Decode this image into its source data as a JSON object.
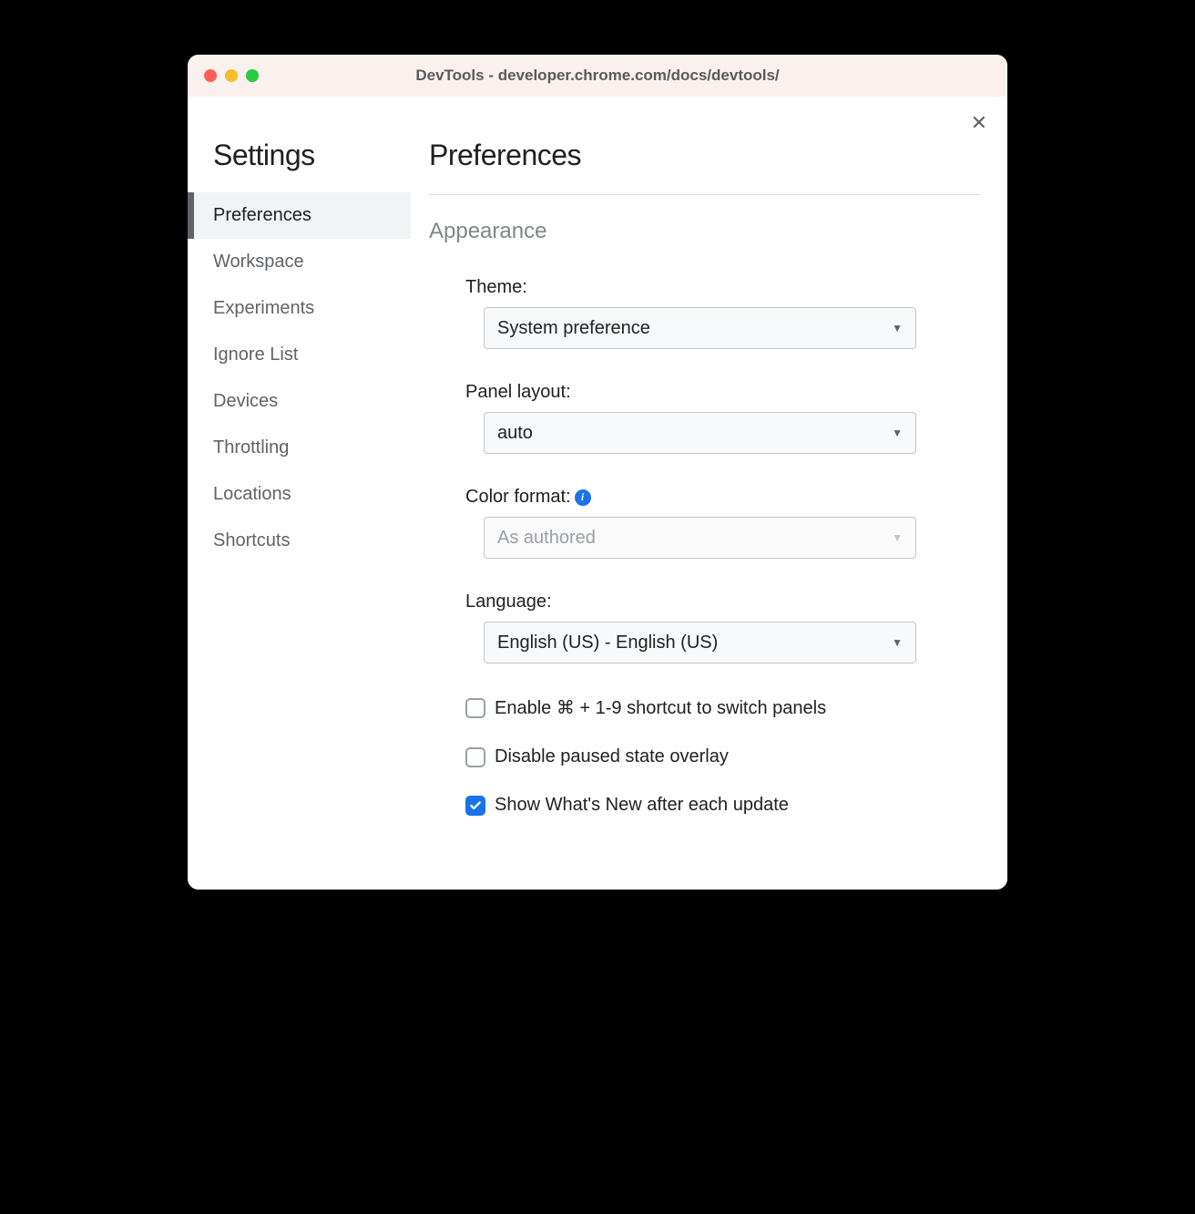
{
  "window": {
    "title": "DevTools - developer.chrome.com/docs/devtools/"
  },
  "sidebar": {
    "title": "Settings",
    "items": [
      {
        "label": "Preferences",
        "active": true
      },
      {
        "label": "Workspace",
        "active": false
      },
      {
        "label": "Experiments",
        "active": false
      },
      {
        "label": "Ignore List",
        "active": false
      },
      {
        "label": "Devices",
        "active": false
      },
      {
        "label": "Throttling",
        "active": false
      },
      {
        "label": "Locations",
        "active": false
      },
      {
        "label": "Shortcuts",
        "active": false
      }
    ]
  },
  "main": {
    "title": "Preferences",
    "section_title": "Appearance",
    "fields": {
      "theme": {
        "label": "Theme:",
        "value": "System preference",
        "disabled": false
      },
      "panel_layout": {
        "label": "Panel layout:",
        "value": "auto",
        "disabled": false
      },
      "color_format": {
        "label": "Color format:",
        "value": "As authored",
        "disabled": true,
        "has_info": true
      },
      "language": {
        "label": "Language:",
        "value": "English (US) - English (US)",
        "disabled": false
      }
    },
    "checkboxes": [
      {
        "label": "Enable ⌘ + 1-9 shortcut to switch panels",
        "checked": false
      },
      {
        "label": "Disable paused state overlay",
        "checked": false
      },
      {
        "label": "Show What's New after each update",
        "checked": true
      }
    ]
  }
}
